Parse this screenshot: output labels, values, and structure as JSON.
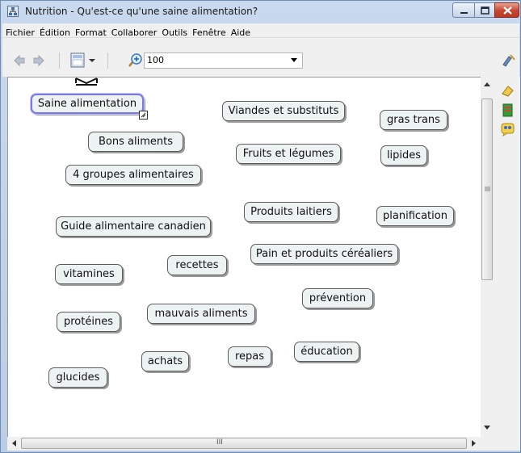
{
  "window": {
    "title": "Nutrition - Qu'est-ce qu'une saine alimentation?"
  },
  "menu": [
    "Fichier",
    "Édition",
    "Format",
    "Collaborer",
    "Outils",
    "Fenêtre",
    "Aide"
  ],
  "toolbar": {
    "zoom_value": "100"
  },
  "concepts": [
    "Saine alimentation",
    "Viandes et substituts",
    "gras trans",
    "Bons  aliments",
    "Fruits et légumes",
    "lipides",
    "4 groupes alimentaires",
    "Produits laitiers",
    "planification",
    "Guide alimentaire canadien",
    "Pain et produits céréaliers",
    "vitamines",
    "recettes",
    "prévention",
    "protéines",
    "mauvais aliments",
    "achats",
    "repas",
    "éducation",
    "glucides"
  ],
  "scrollbar": {
    "grip": "III"
  },
  "colors": {
    "node_fill": "#edf2f2",
    "selection": "#7a7ae6"
  }
}
